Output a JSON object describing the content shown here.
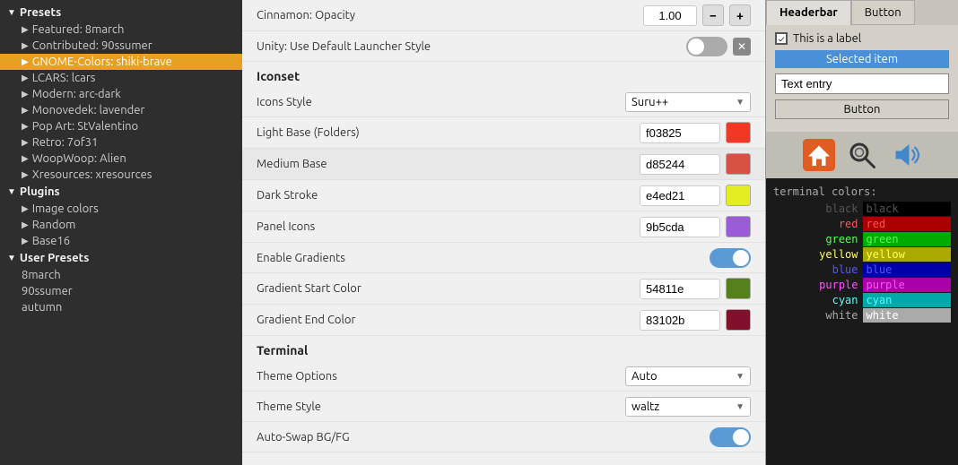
{
  "sidebar": {
    "sections": [
      {
        "label": "Presets",
        "expanded": true,
        "items": [
          {
            "label": "Featured: 8march",
            "active": false
          },
          {
            "label": "Contributed: 90ssumer",
            "active": false
          },
          {
            "label": "GNOME-Colors: shiki-brave",
            "active": true
          },
          {
            "label": "LCARS: lcars",
            "active": false
          },
          {
            "label": "Modern: arc-dark",
            "active": false
          },
          {
            "label": "Monovedek: lavender",
            "active": false
          },
          {
            "label": "Pop Art: StValentino",
            "active": false
          },
          {
            "label": "Retro: 7of31",
            "active": false
          },
          {
            "label": "WoopWoop: Alien",
            "active": false
          },
          {
            "label": "Xresources: xresources",
            "active": false
          }
        ]
      },
      {
        "label": "Plugins",
        "expanded": true,
        "items": [
          {
            "label": "Image colors",
            "active": false
          },
          {
            "label": "Random",
            "active": false
          },
          {
            "label": "Base16",
            "active": false
          }
        ]
      },
      {
        "label": "User Presets",
        "expanded": true,
        "items": [
          {
            "label": "8march",
            "active": false
          },
          {
            "label": "90ssumer",
            "active": false
          },
          {
            "label": "autumn",
            "active": false
          }
        ]
      }
    ]
  },
  "main": {
    "cinnamon_opacity_label": "Cinnamon: Opacity",
    "cinnamon_opacity_value": "1.00",
    "unity_label": "Unity: Use Default Launcher Style",
    "iconset_title": "Iconset",
    "icons_style_label": "Icons Style",
    "icons_style_value": "Suru++",
    "light_base_label": "Light Base (Folders)",
    "light_base_hex": "f03825",
    "light_base_color": "#f03825",
    "medium_base_label": "Medium Base",
    "medium_base_hex": "d85244",
    "medium_base_color": "#d85244",
    "dark_stroke_label": "Dark Stroke",
    "dark_stroke_hex": "e4ed21",
    "dark_stroke_color": "#e4ed21",
    "panel_icons_label": "Panel Icons",
    "panel_icons_hex": "9b5cda",
    "panel_icons_color": "#9b5cda",
    "enable_gradients_label": "Enable Gradients",
    "gradient_start_label": "Gradient Start Color",
    "gradient_start_hex": "54811e",
    "gradient_start_color": "#54811e",
    "gradient_end_label": "Gradient End Color",
    "gradient_end_hex": "83102b",
    "gradient_end_color": "#83102b",
    "terminal_title": "Terminal",
    "theme_options_label": "Theme Options",
    "theme_options_value": "Auto",
    "theme_style_label": "Theme Style",
    "theme_style_value": "waltz",
    "auto_swap_label": "Auto-Swap BG/FG"
  },
  "preview": {
    "tab_headerbar": "Headerbar",
    "tab_button": "Button",
    "checkbox_label": "This is a label",
    "selected_item": "Selected item",
    "text_entry": "Text entry",
    "button_label": "Button",
    "terminal_title": "terminal colors:",
    "terminal_colors": [
      {
        "name": "black",
        "left_class": "term-black-l",
        "right_class": "term-black-r"
      },
      {
        "name": "red",
        "left_class": "term-red-l",
        "right_class": "term-red-r"
      },
      {
        "name": "green",
        "left_class": "term-green-l",
        "right_class": "term-green-r"
      },
      {
        "name": "yellow",
        "left_class": "term-yellow-l",
        "right_class": "term-yellow-r"
      },
      {
        "name": "blue",
        "left_class": "term-blue-l",
        "right_class": "term-blue-r"
      },
      {
        "name": "purple",
        "left_class": "term-purple-l",
        "right_class": "term-purple-r"
      },
      {
        "name": "cyan",
        "left_class": "term-cyan-l",
        "right_class": "term-cyan-r"
      },
      {
        "name": "white",
        "left_class": "term-white-l",
        "right_class": "term-white-r"
      }
    ]
  }
}
